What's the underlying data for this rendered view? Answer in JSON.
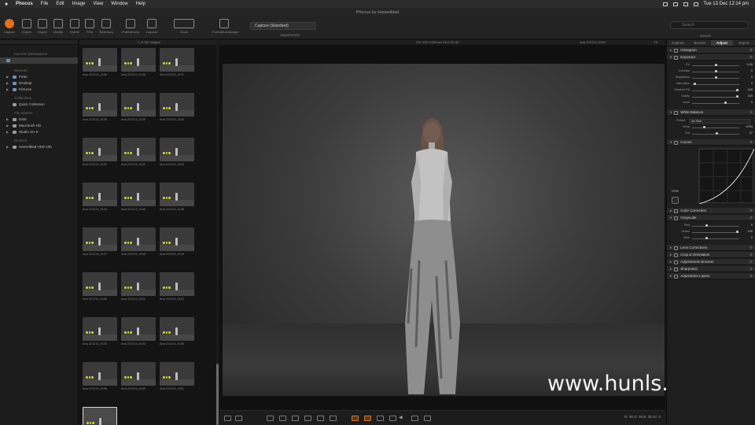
{
  "menubar": {
    "app": "Phocus",
    "items": [
      "File",
      "Edit",
      "Image",
      "View",
      "Window",
      "Help"
    ],
    "clock": "Tue 13 Dec  12:14 pm"
  },
  "window_title": "Phocus by Hasselblad",
  "toolbar": {
    "buttons": [
      "Capture",
      "Export",
      "Import",
      "Modify",
      "Delete",
      "Print",
      "Slideshow",
      "Preferences",
      "Layouts",
      "Show",
      "Portrait/Landscape"
    ],
    "preset": "Capture (Standard)",
    "adjustments_label": "Adjustments",
    "search_label": "Search",
    "search_placeholder": "Search"
  },
  "sidebar": {
    "top_item": "Favorite Destinations",
    "sections": [
      {
        "title": "Recents",
        "items": [
          "Peter",
          "Desktop",
          "Pictures"
        ]
      },
      {
        "title": "Collections",
        "items": [
          "Quick Collection"
        ]
      },
      {
        "title": "File System",
        "items": [
          "Data",
          "Macintosh HD",
          "Studio Srv 8"
        ]
      },
      {
        "title": "Devices",
        "items": [
          "Hasselblad HNS 10b"
        ]
      }
    ]
  },
  "browser": {
    "header": "1 of 187 images",
    "thumbnails": [
      "Ana 221213_0136",
      "Ana 221213_0138",
      "Ana 221213_0137",
      "Ana 221213_0139",
      "Ana 221213_0138",
      "Ana 221213_0140",
      "Ana 221213_0141",
      "Ana 221213_0142",
      "Ana 221213_0143",
      "Ana 221213_0144",
      "Ana 221213_0145",
      "Ana 221213_0146",
      "Ana 221213_0147",
      "Ana 221213_0148",
      "Ana 221213_0149",
      "Ana 221213_0150",
      "Ana 221213_0151",
      "Ana 221213_0152",
      "Ana 221213_0153",
      "Ana 221213_0154",
      "Ana 221213_0155",
      "Ana 221213_0156",
      "Ana 221213_0160",
      "Ana 221213_0161",
      "Ana 221213_0162"
    ]
  },
  "viewer": {
    "exif": "ISO 100  1/250 sec  f/8.0  HC 80",
    "filename": "Ana 221213_0162",
    "zoom": "Fit",
    "readout": "R: 38  G: 38  B: 38  Gr: 0"
  },
  "watermark": "www.hunls.com",
  "panel": {
    "tabs": [
      "Capture",
      "Browse",
      "Adjust",
      "Export"
    ],
    "active_tab": "Adjust",
    "tools": {
      "histogram": "Histogram",
      "exposure": "Exposure",
      "white_balance": "White Balance",
      "curves": "Curves",
      "color_correction": "Color Correction",
      "grayscale": "Grayscale",
      "lens_corrections": "Lens Corrections",
      "crop": "Crop & Orientation",
      "adjustments_browser": "Adjustments Browser",
      "sharpness": "Sharpness",
      "adjustment_layers": "Adjustment Layers"
    },
    "exposure_sliders": [
      {
        "label": "EV",
        "value": "0.00",
        "level": 0.5
      },
      {
        "label": "Contrast",
        "value": "0",
        "level": 0.5
      },
      {
        "label": "Brightness",
        "value": "0",
        "level": 0.5
      },
      {
        "label": "Saturation",
        "value": "0",
        "level": 0.05
      },
      {
        "label": "Shadow Fill",
        "value": "100",
        "level": 0.95
      },
      {
        "label": "Clarity",
        "value": "100",
        "level": 0.95
      },
      {
        "label": "Level",
        "value": "0",
        "level": 0.7
      }
    ],
    "wb_preset_label": "Preset",
    "wb_preset": "As Shot",
    "wb_sliders": [
      {
        "label": "Temp",
        "value": "4794",
        "level": 0.25
      },
      {
        "label": "Tint",
        "value": "37",
        "level": 0.52
      }
    ],
    "curves_channel": "RGB",
    "grayscale_sliders": [
      {
        "label": "Red",
        "value": "0",
        "level": 0.3
      },
      {
        "label": "Green",
        "value": "100",
        "level": 0.95
      },
      {
        "label": "Blue",
        "value": "0",
        "level": 0.3
      }
    ]
  }
}
